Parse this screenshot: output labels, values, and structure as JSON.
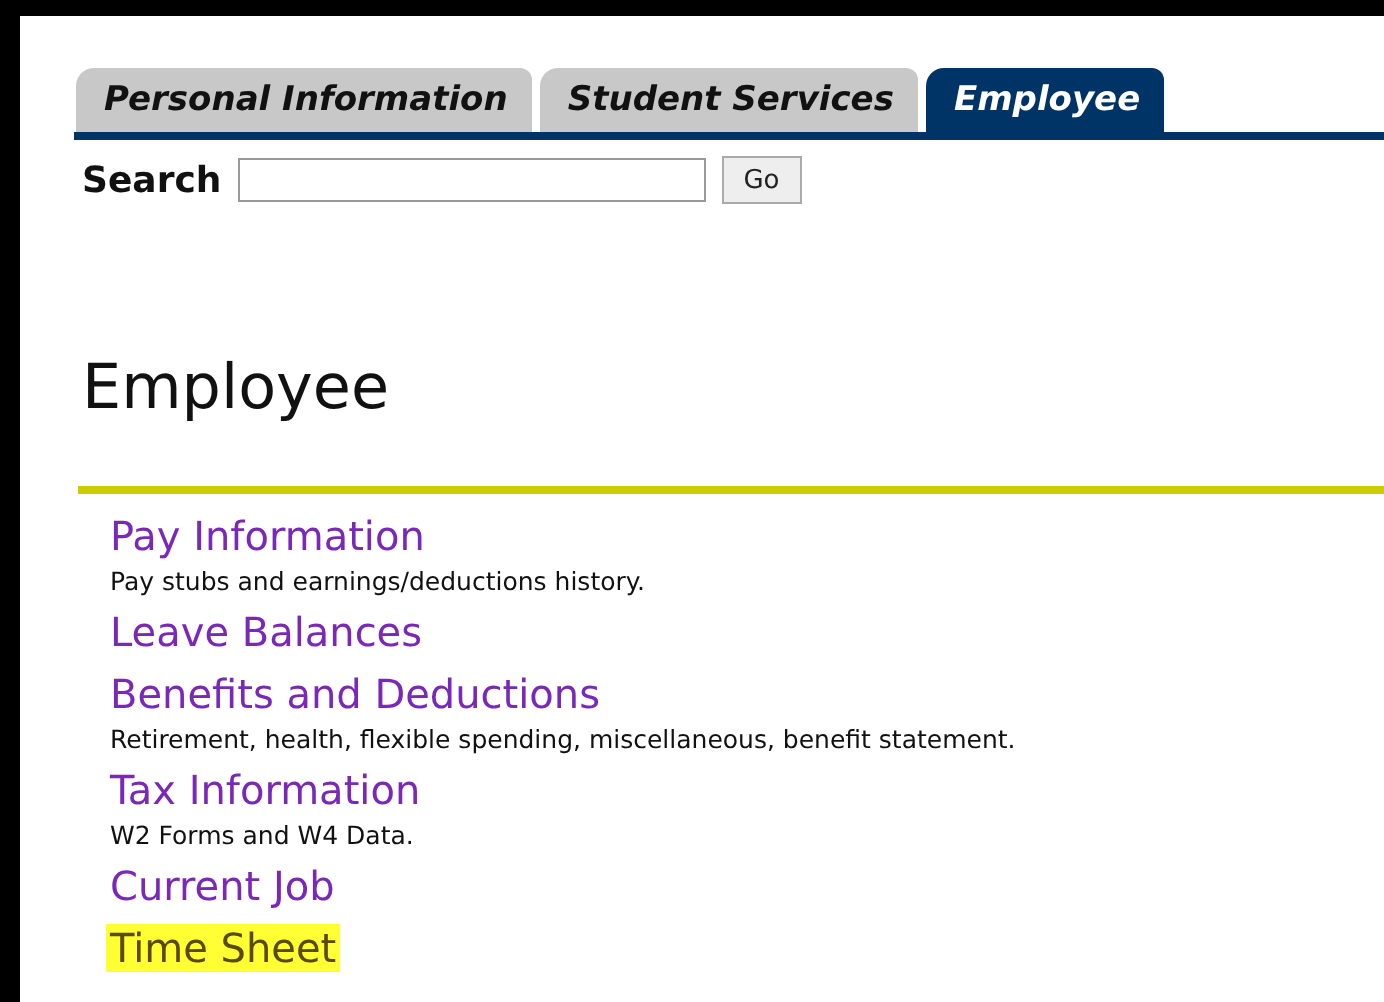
{
  "tabs": [
    {
      "label": "Personal Information",
      "selected": false
    },
    {
      "label": "Student Services",
      "selected": false
    },
    {
      "label": "Employee",
      "selected": true
    }
  ],
  "search": {
    "label": "Search",
    "button": "Go"
  },
  "heading": "Employee",
  "menu": [
    {
      "label": "Pay Information",
      "description": "Pay stubs and earnings/deductions history.",
      "highlighted": false
    },
    {
      "label": "Leave Balances",
      "highlighted": false
    },
    {
      "label": "Benefits and Deductions",
      "description": "Retirement, health, flexible spending, miscellaneous, benefit statement.",
      "highlighted": false
    },
    {
      "label": "Tax Information",
      "description": "W2 Forms and W4 Data.",
      "highlighted": false
    },
    {
      "label": "Current Job",
      "highlighted": false
    },
    {
      "label": "Time Sheet",
      "highlighted": true
    }
  ]
}
